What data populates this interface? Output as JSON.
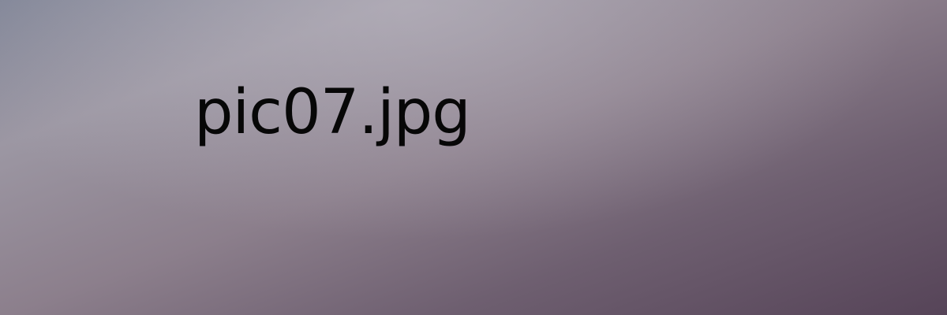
{
  "caption": {
    "text": "pic07.jpg"
  },
  "colors": {
    "text": "#070707",
    "gradient_top_left": "#7f8496",
    "gradient_highlight": "#b5b2bc",
    "gradient_bottom_right": "#564458"
  }
}
